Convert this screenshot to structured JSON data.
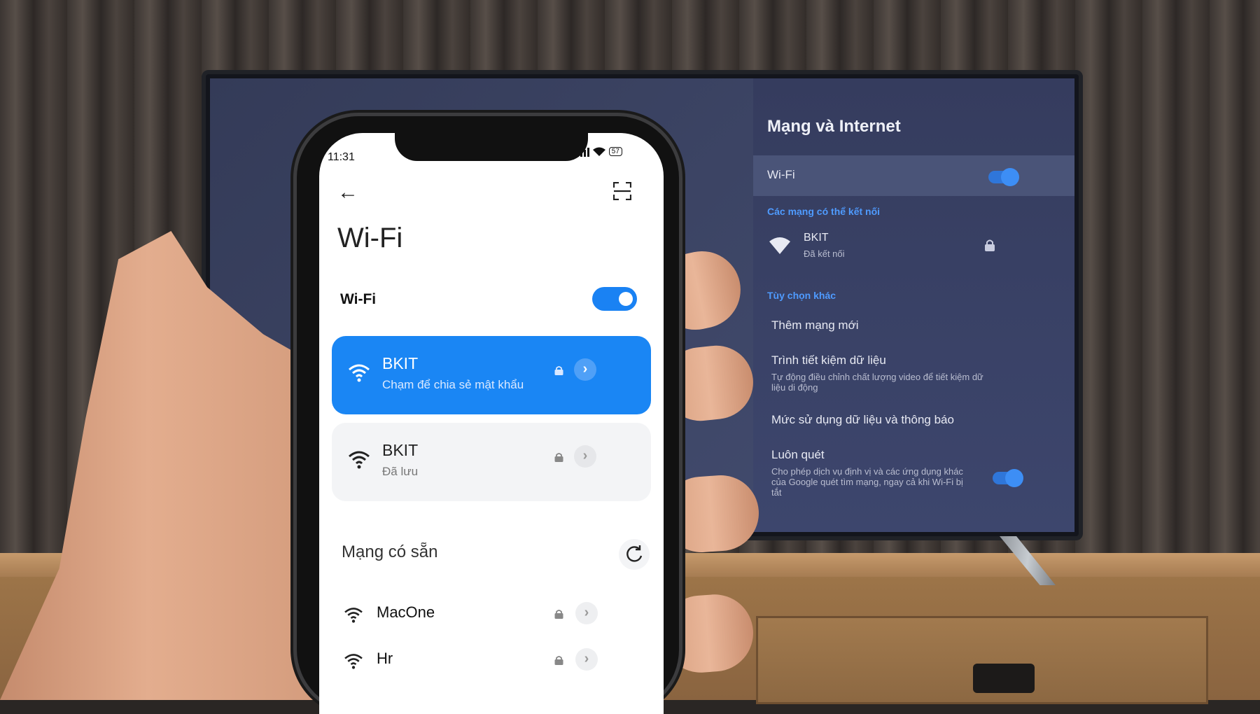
{
  "tv": {
    "title": "Mạng và Internet",
    "wifi_label": "Wi-Fi",
    "wifi_enabled": true,
    "section_available": "Các mạng có thể kết nối",
    "network": {
      "name": "BKIT",
      "status": "Đã kết nối"
    },
    "section_other": "Tùy chọn khác",
    "options": [
      {
        "title": "Thêm mạng mới"
      },
      {
        "title": "Trình tiết kiệm dữ liệu",
        "subtitle": "Tự động điều chỉnh chất lượng video để tiết kiệm dữ liệu di động"
      },
      {
        "title": "Mức sử dụng dữ liệu và thông báo"
      },
      {
        "title": "Luôn quét",
        "subtitle": "Cho phép dịch vụ định vị và các ứng dụng khác của Google quét tìm mạng, ngay cả khi Wi-Fi bị tắt"
      }
    ],
    "always_scan_enabled": true
  },
  "phone": {
    "status_time": "11:31",
    "battery": "57",
    "title": "Wi-Fi",
    "wifi_label": "Wi-Fi",
    "wifi_enabled": true,
    "connected": {
      "name": "BKIT",
      "subtitle": "Chạm để chia sẻ mật khẩu"
    },
    "saved": {
      "name": "BKIT",
      "subtitle": "Đã lưu"
    },
    "available_header": "Mạng có sẵn",
    "available_networks": [
      {
        "name": "MacOne"
      },
      {
        "name": "Hr"
      }
    ]
  },
  "colors": {
    "accent": "#1a86f4",
    "tv_accent": "#4f9bff"
  }
}
